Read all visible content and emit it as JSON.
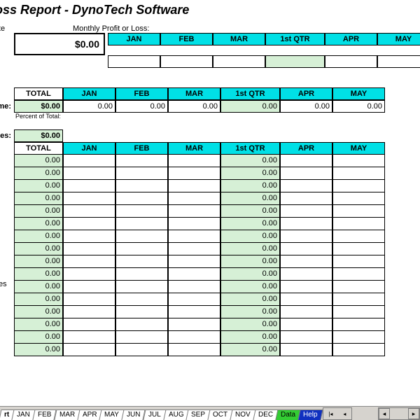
{
  "title": "fit Loss Report - DynoTech Software",
  "net": {
    "label": "fit to Date",
    "value": "$0.00"
  },
  "monthly_label": "Monthly Profit or Loss:",
  "months": [
    "JAN",
    "FEB",
    "MAR",
    "1st QTR",
    "APR",
    "MAY"
  ],
  "profit_cells": [
    "",
    "",
    "",
    "",
    "",
    ""
  ],
  "income": {
    "row_label": "me:",
    "total_header": "TOTAL",
    "total_value": "$0.00",
    "cells": [
      "0.00",
      "0.00",
      "0.00",
      "0.00",
      "0.00",
      "0.00"
    ],
    "percent_label": "Percent of Total:"
  },
  "expenses": {
    "row_label": "ses:",
    "side_label": "es",
    "grand_total": "$0.00",
    "total_header": "TOTAL",
    "rows": [
      {
        "t": "0.00",
        "c": [
          "",
          "",
          "",
          "0.00",
          "",
          ""
        ]
      },
      {
        "t": "0.00",
        "c": [
          "",
          "",
          "",
          "0.00",
          "",
          ""
        ]
      },
      {
        "t": "0.00",
        "c": [
          "",
          "",
          "",
          "0.00",
          "",
          ""
        ]
      },
      {
        "t": "0.00",
        "c": [
          "",
          "",
          "",
          "0.00",
          "",
          ""
        ]
      },
      {
        "t": "0.00",
        "c": [
          "",
          "",
          "",
          "0.00",
          "",
          ""
        ]
      },
      {
        "t": "0.00",
        "c": [
          "",
          "",
          "",
          "0.00",
          "",
          ""
        ]
      },
      {
        "t": "0.00",
        "c": [
          "",
          "",
          "",
          "0.00",
          "",
          ""
        ]
      },
      {
        "t": "0.00",
        "c": [
          "",
          "",
          "",
          "0.00",
          "",
          ""
        ]
      },
      {
        "t": "0.00",
        "c": [
          "",
          "",
          "",
          "0.00",
          "",
          ""
        ]
      },
      {
        "t": "0.00",
        "c": [
          "",
          "",
          "",
          "0.00",
          "",
          ""
        ]
      },
      {
        "t": "0.00",
        "c": [
          "",
          "",
          "",
          "0.00",
          "",
          ""
        ]
      },
      {
        "t": "0.00",
        "c": [
          "",
          "",
          "",
          "0.00",
          "",
          ""
        ]
      },
      {
        "t": "0.00",
        "c": [
          "",
          "",
          "",
          "0.00",
          "",
          ""
        ]
      },
      {
        "t": "0.00",
        "c": [
          "",
          "",
          "",
          "0.00",
          "",
          ""
        ]
      },
      {
        "t": "0.00",
        "c": [
          "",
          "",
          "",
          "0.00",
          "",
          ""
        ]
      },
      {
        "t": "0.00",
        "c": [
          "",
          "",
          "",
          "0.00",
          "",
          ""
        ]
      }
    ]
  },
  "tabs": [
    "rt",
    "JAN",
    "FEB",
    "MAR",
    "APR",
    "MAY",
    "JUN",
    "JUL",
    "AUG",
    "SEP",
    "OCT",
    "NOV",
    "DEC",
    "Data",
    "Help"
  ]
}
